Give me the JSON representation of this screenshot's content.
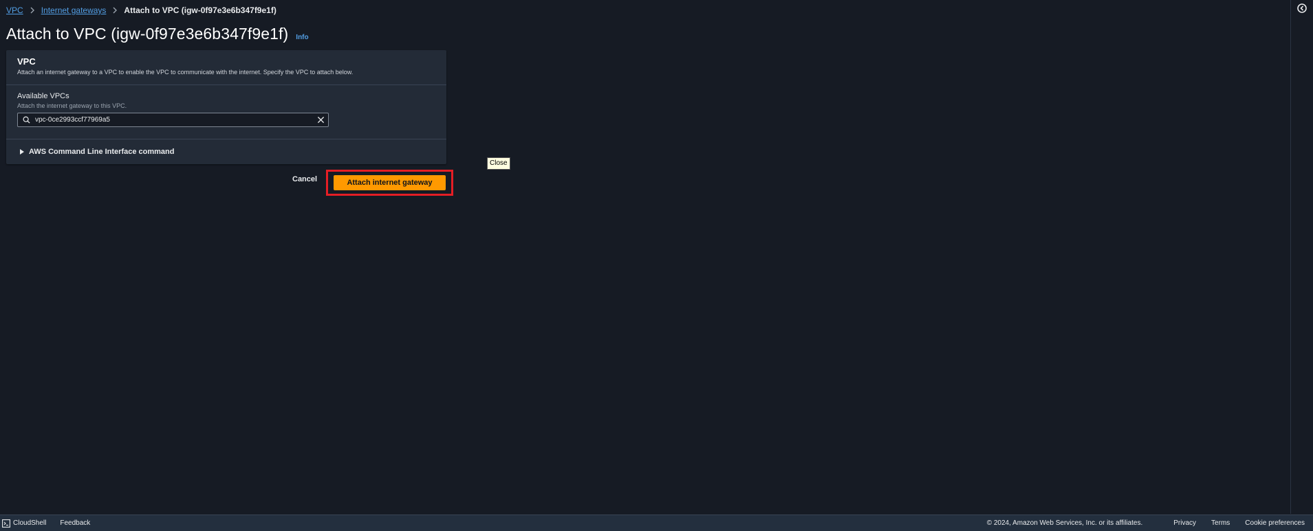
{
  "breadcrumb": {
    "items": [
      {
        "label": "VPC"
      },
      {
        "label": "Internet gateways"
      }
    ],
    "current": "Attach to VPC (igw-0f97e3e6b347f9e1f)"
  },
  "page": {
    "title": "Attach to VPC (igw-0f97e3e6b347f9e1f)",
    "info_label": "Info"
  },
  "panel": {
    "title": "VPC",
    "description": "Attach an internet gateway to a VPC to enable the VPC to communicate with the internet. Specify the VPC to attach below.",
    "field": {
      "label": "Available VPCs",
      "description": "Attach the internet gateway to this VPC.",
      "value": "vpc-0ce2993ccf77969a5"
    },
    "expander_label": "AWS Command Line Interface command"
  },
  "actions": {
    "cancel_label": "Cancel",
    "attach_label": "Attach internet gateway",
    "highlight_color": "#e51e25",
    "primary_color": "#ff9900"
  },
  "tooltip": {
    "text": "Close"
  },
  "footer": {
    "cloudshell_label": "CloudShell",
    "feedback_label": "Feedback",
    "copyright": "© 2024, Amazon Web Services, Inc. or its affiliates.",
    "privacy_label": "Privacy",
    "terms_label": "Terms",
    "cookie_label": "Cookie preferences"
  },
  "icons": {
    "rail": "notifications-circle-icon",
    "search": "search-icon",
    "clear": "close-icon",
    "expander": "caret-right-icon",
    "cloudshell": "terminal-icon"
  }
}
